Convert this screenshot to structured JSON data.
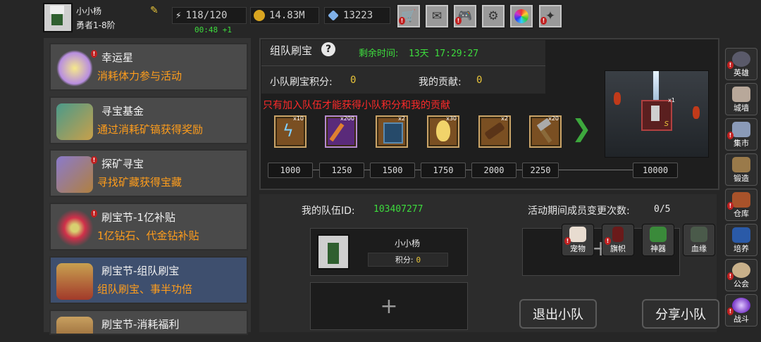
{
  "player": {
    "name": "小小杨",
    "rank": "勇者1-8阶",
    "stamina": "118/120",
    "stamina_timer": "00:48 +1",
    "gold": "14.83M",
    "diamonds": "13223"
  },
  "toolbar": {
    "icons": [
      "shop-icon",
      "mail-icon",
      "gamepad-icon",
      "settings-icon",
      "color-wheel-icon",
      "firework-icon"
    ]
  },
  "events": [
    {
      "title": "幸运星",
      "subtitle": "消耗体力参与活动",
      "badge": true
    },
    {
      "title": "寻宝基金",
      "subtitle": "通过消耗矿镐获得奖励",
      "badge": false
    },
    {
      "title": "探矿寻宝",
      "subtitle": "寻找矿藏获得宝藏",
      "badge": true
    },
    {
      "title": "刷宝节-1亿补贴",
      "subtitle": "1亿钻石、代金钻补贴",
      "badge": true
    },
    {
      "title": "刷宝节-组队刷宝",
      "subtitle": "组队刷宝、事半功倍",
      "badge": false
    },
    {
      "title": "刷宝节-消耗福利",
      "subtitle": "",
      "badge": false
    }
  ],
  "event_panel": {
    "title": "组队刷宝",
    "help": "?",
    "remaining_label": "剩余时间:",
    "remaining_value": "13天 17:29:27",
    "team_points_label": "小队刷宝积分:",
    "team_points_value": "0",
    "contribution_label": "我的贡献:",
    "contribution_value": "0",
    "warning": "只有加入队伍才能获得小队积分和我的贡献",
    "rewards": [
      {
        "icon": "lightning-scroll-icon",
        "count": "x10"
      },
      {
        "icon": "fire-staff-icon",
        "count": "x200"
      },
      {
        "icon": "spellbook-icon",
        "count": "x2"
      },
      {
        "icon": "golden-egg-icon",
        "count": "x30"
      },
      {
        "icon": "scroll-icon",
        "count": "x2"
      },
      {
        "icon": "hammer-icon",
        "count": "x20"
      }
    ],
    "milestones": [
      "1000",
      "1250",
      "1500",
      "1750",
      "2000",
      "2250",
      "10000"
    ],
    "grand_prize_count": "x1"
  },
  "team": {
    "id_label": "我的队伍ID:",
    "id_value": "103407277",
    "changes_label": "活动期间成员变更次数:",
    "changes_value": "0/5",
    "member_name": "小小杨",
    "member_points_label": "积分:",
    "member_points_value": "0",
    "add_symbol": "+",
    "leave_button": "退出小队",
    "share_button": "分享小队"
  },
  "quick_menu": [
    {
      "label": "宠物",
      "icon": "cat-icon"
    },
    {
      "label": "旗帜",
      "icon": "banner-icon"
    },
    {
      "label": "神器",
      "icon": "artifact-icon"
    },
    {
      "label": "血缘",
      "icon": "armor-icon"
    }
  ],
  "sidebar": [
    {
      "label": "英雄",
      "icon": "helmet-icon"
    },
    {
      "label": "城墙",
      "icon": "wall-icon"
    },
    {
      "label": "集市",
      "icon": "market-icon"
    },
    {
      "label": "锻造",
      "icon": "anvil-icon"
    },
    {
      "label": "仓库",
      "icon": "chest-icon"
    },
    {
      "label": "培养",
      "icon": "training-icon"
    },
    {
      "label": "公会",
      "icon": "guild-icon"
    },
    {
      "label": "战斗",
      "icon": "portal-icon"
    }
  ]
}
